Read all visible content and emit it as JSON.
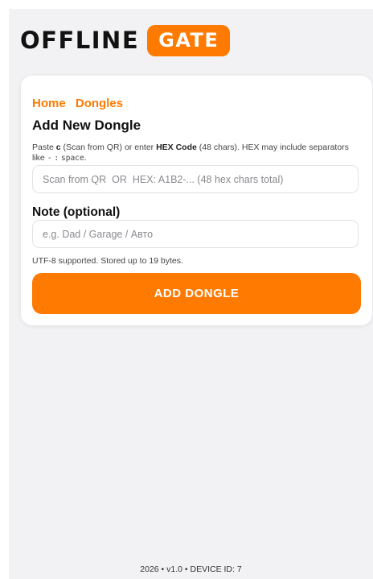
{
  "brand": {
    "word1": "OFFLINE",
    "word2": "GATE",
    "accent_color": "#ff7a00"
  },
  "breadcrumb": {
    "home": "Home",
    "dongles": "Dongles"
  },
  "page": {
    "title": "Add New Dongle"
  },
  "help": {
    "t1": "Paste ",
    "b1": "c",
    "t2": " (Scan from QR) or enter ",
    "b2": "HEX Code",
    "t3": " (48 chars). HEX may include separators like ",
    "c1": "-",
    "t4": " ",
    "c2": ":",
    "t5": " ",
    "c3": "space",
    "t6": "."
  },
  "code_input": {
    "value": "",
    "placeholder": "Scan from QR  OR  HEX: A1B2-... (48 hex chars total)"
  },
  "note": {
    "label": "Note (optional)",
    "value": "",
    "placeholder": "e.g. Dad / Garage / Авто",
    "hint": "UTF-8 supported. Stored up to 19 bytes."
  },
  "actions": {
    "add_label": "ADD DONGLE"
  },
  "footer": {
    "text": "2026 • v1.0 • DEVICE ID: 7"
  }
}
